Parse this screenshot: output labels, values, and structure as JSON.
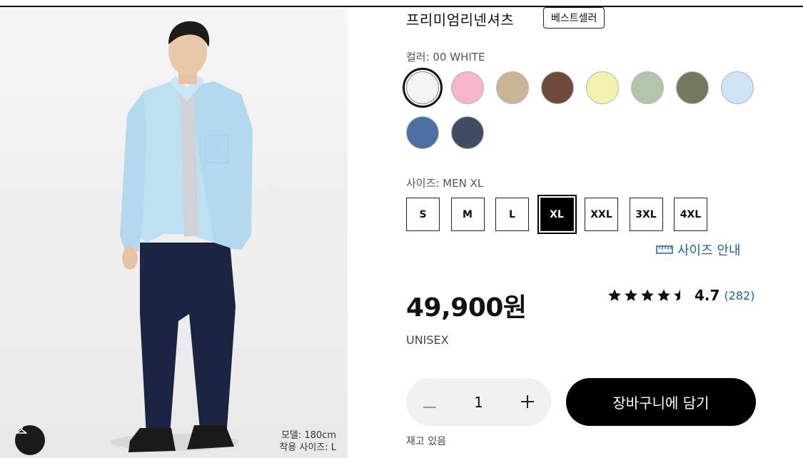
{
  "product": {
    "title": "프리미엄리넨셔츠",
    "badge": "베스트셀러",
    "color_label": "컬러: 00 WHITE",
    "size_label": "사이즈: MEN XL",
    "size_guide_label": "사이즈 안내",
    "price": "49,900원",
    "gender": "UNISEX",
    "rating_score": "4.7",
    "rating_count": "(282)",
    "rating_value": 4.7,
    "quantity": "1",
    "add_to_cart_label": "장바구니에 담기",
    "stock_status": "재고 있음"
  },
  "model": {
    "height_line": "모델: 180cm",
    "size_line": "착용 사이즈: L"
  },
  "colors": [
    {
      "name": "white",
      "hex": "#f3f3f1",
      "selected": true
    },
    {
      "name": "pink",
      "hex": "#f4b6c8",
      "selected": false
    },
    {
      "name": "beige",
      "hex": "#c9b597",
      "selected": false
    },
    {
      "name": "brown",
      "hex": "#6e4a3b",
      "selected": false
    },
    {
      "name": "yellow",
      "hex": "#f6f0ae",
      "selected": false
    },
    {
      "name": "light-green",
      "hex": "#b4c4aa",
      "selected": false
    },
    {
      "name": "olive",
      "hex": "#717a5f",
      "selected": false
    },
    {
      "name": "light-blue",
      "hex": "#cfe4f5",
      "selected": false
    },
    {
      "name": "blue",
      "hex": "#4d6fa3",
      "selected": false
    },
    {
      "name": "navy",
      "hex": "#3f4c63",
      "selected": false
    }
  ],
  "sizes": [
    {
      "label": "S",
      "selected": false
    },
    {
      "label": "M",
      "selected": false
    },
    {
      "label": "L",
      "selected": false
    },
    {
      "label": "XL",
      "selected": true
    },
    {
      "label": "XXL",
      "selected": false
    },
    {
      "label": "3XL",
      "selected": false
    },
    {
      "label": "4XL",
      "selected": false
    }
  ],
  "icons": {
    "hanger": "hanger-icon",
    "ruler": "ruler-icon",
    "star": "star-icon",
    "minus": "minus-icon",
    "plus": "plus-icon"
  },
  "theme": {
    "accent": "#1f5fa6",
    "primary": "#000000",
    "shirt": "#bfe0f3",
    "pants": "#1b2440"
  }
}
